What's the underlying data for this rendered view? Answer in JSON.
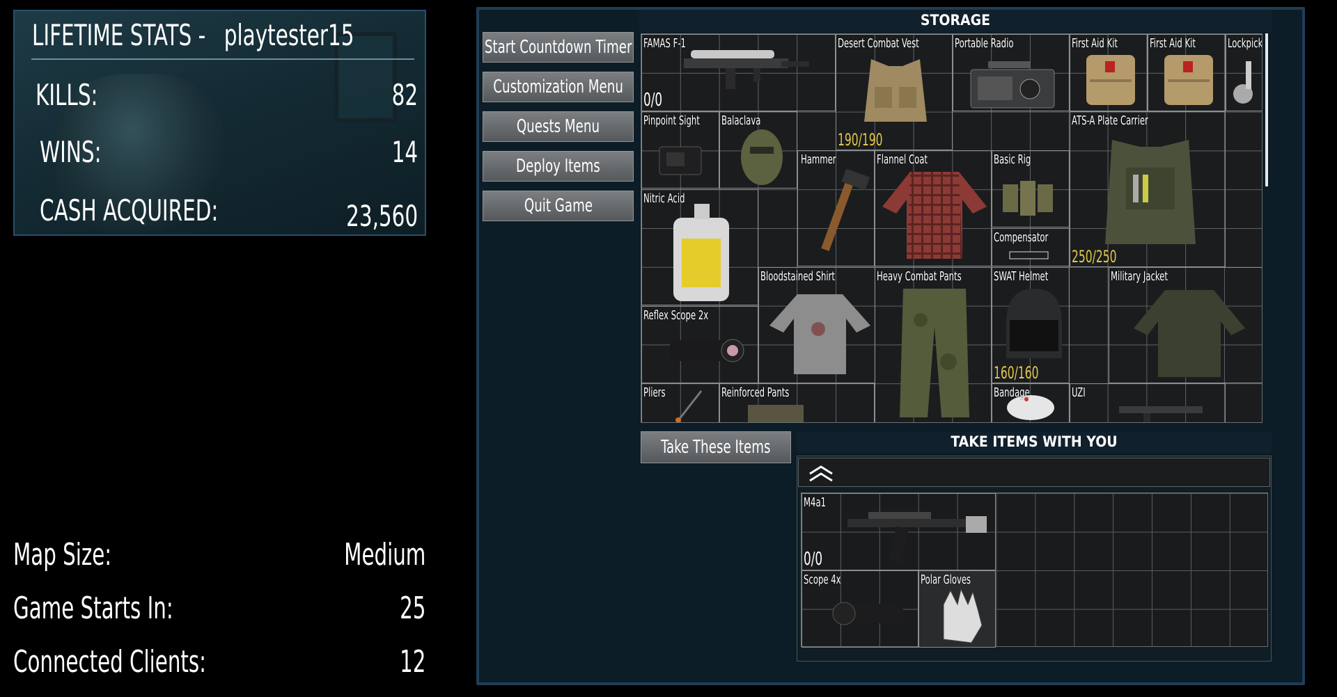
{
  "lifetime_stats": {
    "title": "LIFETIME STATS -",
    "username": "playtester15",
    "rows": [
      {
        "label": "KILLS:",
        "value": "82"
      },
      {
        "label": "WINS:",
        "value": "14"
      },
      {
        "label": "CASH ACQUIRED:",
        "value": "23,560"
      }
    ]
  },
  "game_info": [
    {
      "label": "Map Size:",
      "value": "Medium"
    },
    {
      "label": "Game Starts In:",
      "value": "25"
    },
    {
      "label": "Connected Clients:",
      "value": "12"
    }
  ],
  "menu": [
    "Start Countdown Timer",
    "Customization Menu",
    "Quests Menu",
    "Deploy Items",
    "Quit Game"
  ],
  "storage": {
    "title": "STORAGE",
    "items": [
      {
        "name": "FAMAS F-1",
        "durability": "0/0"
      },
      {
        "name": "Desert Combat Vest",
        "durability": "190/190"
      },
      {
        "name": "Portable Radio"
      },
      {
        "name": "First Aid Kit"
      },
      {
        "name": "First Aid Kit"
      },
      {
        "name": "Lockpick"
      },
      {
        "name": "Pinpoint Sight"
      },
      {
        "name": "Balaclava"
      },
      {
        "name": "ATS-A Plate Carrier",
        "durability": "250/250"
      },
      {
        "name": "Hammer"
      },
      {
        "name": "Flannel Coat"
      },
      {
        "name": "Basic Rig"
      },
      {
        "name": "Nitric Acid"
      },
      {
        "name": "Compensator"
      },
      {
        "name": "Bloodstained Shirt"
      },
      {
        "name": "Heavy Combat Pants"
      },
      {
        "name": "SWAT Helmet",
        "durability": "160/160"
      },
      {
        "name": "Military Jacket"
      },
      {
        "name": "Reflex Scope 2x"
      },
      {
        "name": "Pliers"
      },
      {
        "name": "Reinforced Pants"
      },
      {
        "name": "Bandage"
      },
      {
        "name": "UZI"
      }
    ]
  },
  "take_button": "Take These Items",
  "take_with_you": {
    "title": "TAKE ITEMS WITH YOU",
    "collapse_icon": "double-chevron-up-icon",
    "items": [
      {
        "name": "M4a1",
        "durability": "0/0"
      },
      {
        "name": "Scope 4x"
      },
      {
        "name": "Polar Gloves"
      }
    ]
  },
  "colors": {
    "panel_bg": "#0d1d27",
    "panel_border": "#1f3e57",
    "durability_yellow": "#e4c94a",
    "button_gray": "#6a6e71"
  }
}
